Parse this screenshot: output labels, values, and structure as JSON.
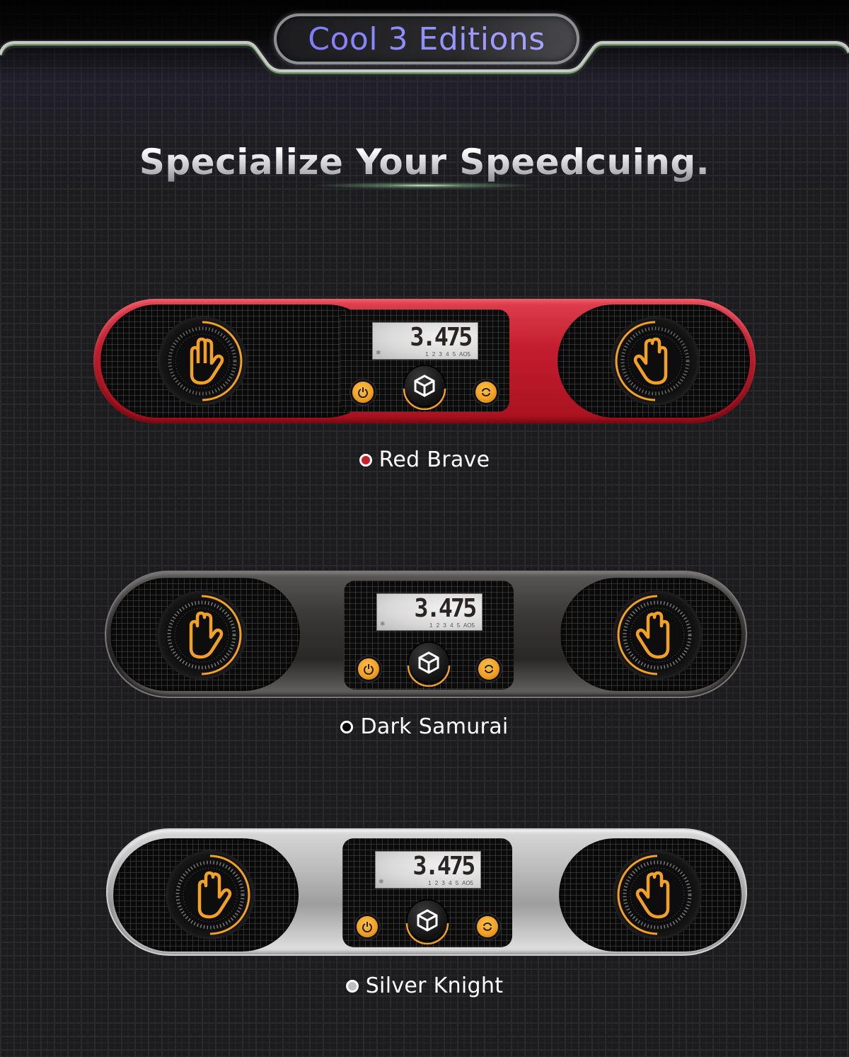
{
  "header": {
    "badge_title": "Cool 3 Editions",
    "headline": "Specialize Your Speedcuing."
  },
  "colors": {
    "badge_text": "#8e8cff",
    "accent_orange": "#f2a124",
    "red_edition": "#c8202f",
    "dark_edition": "#000000",
    "silver_edition": "#bdbdbd"
  },
  "editions": [
    {
      "name": "Red Brave",
      "swatch_color": "#c8202f",
      "display": {
        "time": "3.475",
        "slots": "1 2 3 4 5",
        "mode": "AO5",
        "bluetooth_icon": "bluetooth-icon"
      },
      "icons": {
        "left_pad": "hand-icon",
        "right_pad": "hand-icon",
        "power": "power-icon",
        "reset": "reset-icon",
        "logo": "gan-logo-icon"
      }
    },
    {
      "name": "Dark Samurai",
      "swatch_color": "#000000",
      "display": {
        "time": "3.475",
        "slots": "1 2 3 4 5",
        "mode": "AO5",
        "bluetooth_icon": "bluetooth-icon"
      },
      "icons": {
        "left_pad": "hand-icon",
        "right_pad": "hand-icon",
        "power": "power-icon",
        "reset": "reset-icon",
        "logo": "gan-logo-icon"
      }
    },
    {
      "name": "Silver Knight",
      "swatch_color": "#bdbdbd",
      "display": {
        "time": "3.475",
        "slots": "1 2 3 4 5",
        "mode": "AO5",
        "bluetooth_icon": "bluetooth-icon"
      },
      "icons": {
        "left_pad": "hand-icon",
        "right_pad": "hand-icon",
        "power": "power-icon",
        "reset": "reset-icon",
        "logo": "gan-logo-icon"
      }
    }
  ]
}
